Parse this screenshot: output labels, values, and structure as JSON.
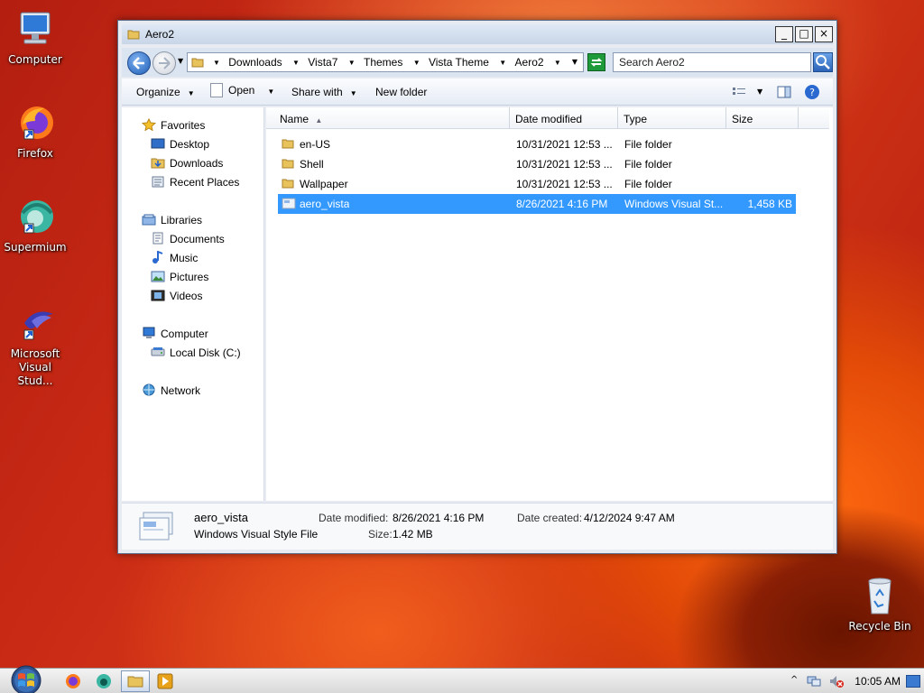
{
  "desktop": {
    "icons": [
      {
        "label": "Computer"
      },
      {
        "label": "Firefox"
      },
      {
        "label": "Supermium"
      },
      {
        "label": "Microsoft Visual Stud..."
      },
      {
        "label": "Recycle Bin"
      }
    ]
  },
  "window": {
    "title": "Aero2",
    "controls": {
      "minimize": "_",
      "maximize": "□",
      "close": "×"
    },
    "breadcrumb": [
      "Downloads",
      "Vista7",
      "Themes",
      "Vista Theme",
      "Aero2"
    ],
    "search_placeholder": "Search Aero2",
    "toolbar": {
      "organize": "Organize",
      "open": "Open",
      "share_with": "Share with",
      "new_folder": "New folder"
    },
    "nav": {
      "favorites": "Favorites",
      "desktop": "Desktop",
      "downloads": "Downloads",
      "recent_places": "Recent Places",
      "libraries": "Libraries",
      "documents": "Documents",
      "music": "Music",
      "pictures": "Pictures",
      "videos": "Videos",
      "computer": "Computer",
      "local_disk": "Local Disk (C:)",
      "network": "Network"
    },
    "columns": {
      "name": "Name",
      "date_modified": "Date modified",
      "type": "Type",
      "size": "Size"
    },
    "files": [
      {
        "name": "en-US",
        "date": "10/31/2021 12:53 ...",
        "type": "File folder",
        "size": ""
      },
      {
        "name": "Shell",
        "date": "10/31/2021 12:53 ...",
        "type": "File folder",
        "size": ""
      },
      {
        "name": "Wallpaper",
        "date": "10/31/2021 12:53 ...",
        "type": "File folder",
        "size": ""
      },
      {
        "name": "aero_vista",
        "date": "8/26/2021 4:16 PM",
        "type": "Windows Visual St...",
        "size": "1,458 KB"
      }
    ],
    "details": {
      "name": "aero_vista",
      "type": "Windows Visual Style File",
      "date_modified_label": "Date modified:",
      "date_modified": "8/26/2021 4:16 PM",
      "date_created_label": "Date created:",
      "date_created": "4/12/2024 9:47 AM",
      "size_label": "Size:",
      "size": "1.42 MB"
    }
  },
  "taskbar": {
    "time": "10:05 AM"
  },
  "colors": {
    "selection": "#3399ff",
    "window_frame": "#5b6f8c"
  }
}
